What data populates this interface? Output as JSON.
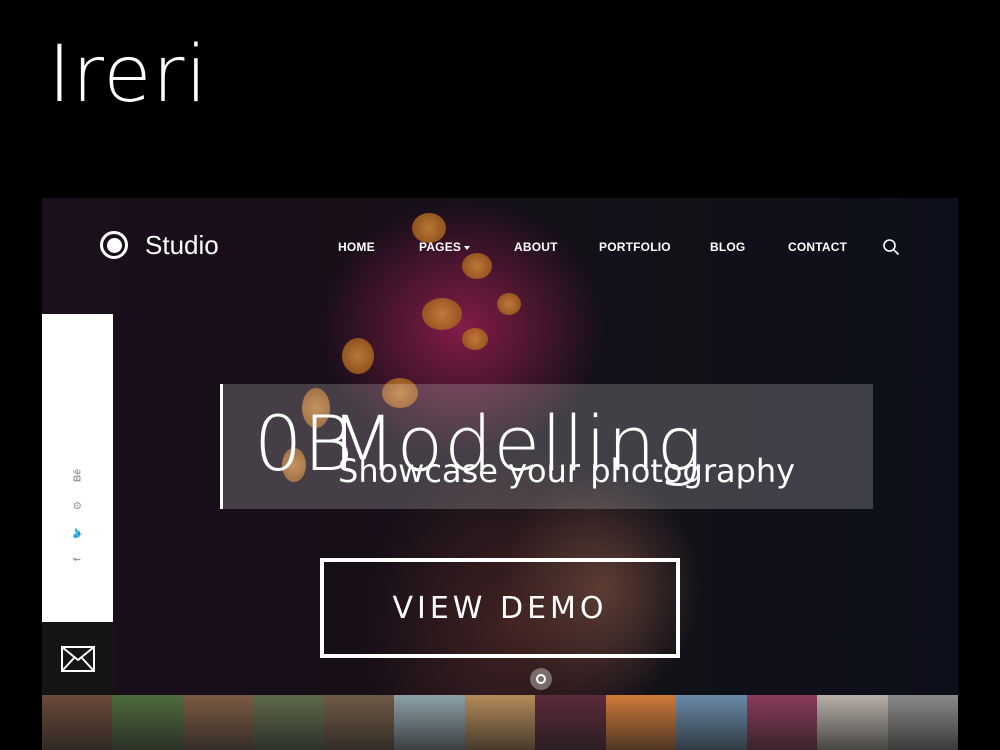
{
  "brand": {
    "name": "Ireri"
  },
  "site": {
    "logo_text": "Studio",
    "nav": [
      {
        "label": "HOME",
        "has_dropdown": false
      },
      {
        "label": "PAGES",
        "has_dropdown": true
      },
      {
        "label": "ABOUT",
        "has_dropdown": false
      },
      {
        "label": "PORTFOLIO",
        "has_dropdown": false
      },
      {
        "label": "BLOG",
        "has_dropdown": false
      },
      {
        "label": "CONTACT",
        "has_dropdown": false
      }
    ],
    "social": [
      "Bē",
      "⊙",
      "🐦",
      "f"
    ]
  },
  "hero": {
    "slide_number": "0B",
    "title": "Modelling",
    "subtitle": "Showcase your photography",
    "cta_label": "VIEW DEMO"
  },
  "thumbnails": [
    {
      "name": "people-crowd",
      "color": "#6b4a3a"
    },
    {
      "name": "village-trees",
      "color": "#4f6b3e"
    },
    {
      "name": "market-group",
      "color": "#7a5a44"
    },
    {
      "name": "forest-people",
      "color": "#5d6b4a"
    },
    {
      "name": "hut-roof",
      "color": "#6f5a45"
    },
    {
      "name": "palm-sky",
      "color": "#8ea0a8"
    },
    {
      "name": "desert-dunes",
      "color": "#b58a5a"
    },
    {
      "name": "portrait-scarf",
      "color": "#5a2a3a"
    },
    {
      "name": "sunset-savanna",
      "color": "#d07a3a"
    },
    {
      "name": "baobab-tree",
      "color": "#6a8aa8"
    },
    {
      "name": "fabric-pattern",
      "color": "#8a3a5a"
    },
    {
      "name": "misty-field",
      "color": "#b8b0a8"
    },
    {
      "name": "grey-landscape",
      "color": "#8a8a88"
    }
  ]
}
